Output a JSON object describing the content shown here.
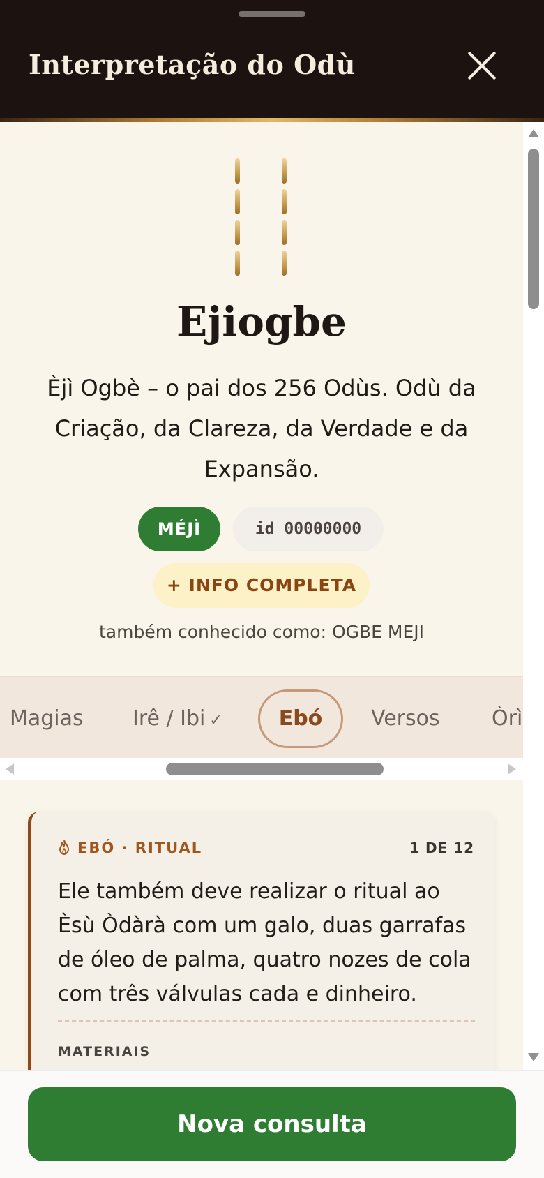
{
  "header": {
    "title": "Interpretação do Odù",
    "close_icon": "close-icon"
  },
  "odu": {
    "name": "Ejiogbe",
    "description": "Èjì Ogbè – o pai dos 256 Odùs. Odù da Criação, da Clareza, da Verdade e da Expansão.",
    "meji_label": "MÉJÌ",
    "id_label": "id 00000000",
    "info_button": "+ INFO COMPLETA",
    "aka": "também conhecido como: OGBE MEJI",
    "marks_icon": "odu-marks",
    "colors": {
      "meji": "#2e7d32",
      "accent": "#8a4512"
    }
  },
  "tabs": {
    "magias": "Magias",
    "ire": "Irê / Ibi",
    "ire_check": "✓",
    "ebo": "Ebó",
    "versos": "Versos",
    "ori": "Òrì",
    "active": "Ebó"
  },
  "card": {
    "tag": "EBÓ · RITUAL",
    "tag_icon": "flame-icon",
    "count": "1 DE 12",
    "text": "Ele também deve realizar o ritual ao Èsù Òdàrà com um galo, duas garrafas de óleo de palma, quatro nozes de cola com três válvulas cada e dinheiro.",
    "materials_label": "MATERIAIS"
  },
  "footer": {
    "button": "Nova consulta",
    "button_color": "#2e7d32"
  }
}
